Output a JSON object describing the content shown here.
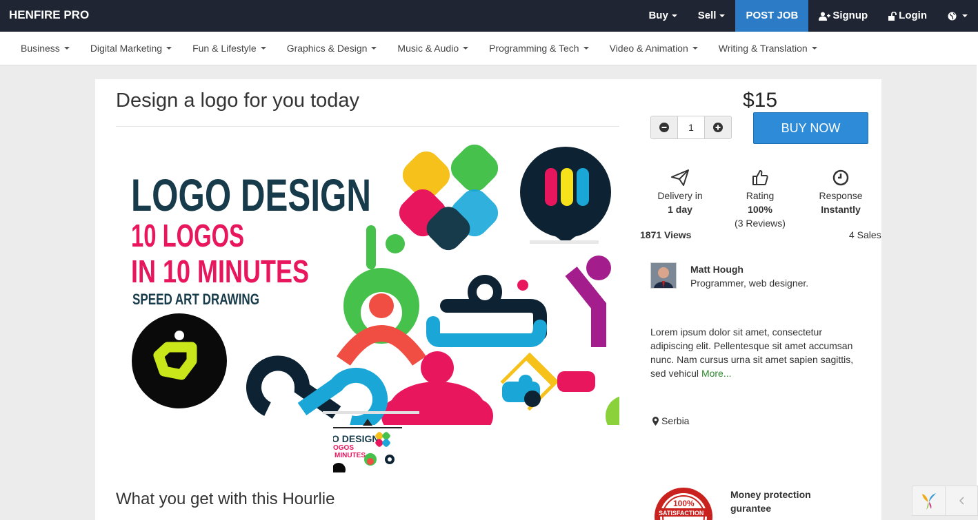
{
  "brand": "HENFIRE PRO",
  "topnav": {
    "buy": "Buy",
    "sell": "Sell",
    "post_job": "POST JOB",
    "signup": "Signup",
    "login": "Login"
  },
  "categories": [
    "Business",
    "Digital Marketing",
    "Fun & Lifestyle",
    "Graphics & Design",
    "Music & Audio",
    "Programming & Tech",
    "Video & Animation",
    "Writing & Translation"
  ],
  "gig": {
    "title": "Design a logo for you today",
    "price": "$15",
    "quantity": "1",
    "buy_label": "BUY NOW",
    "image_text": {
      "line1": "LOGO DESIGN",
      "line2": "10 LOGOS",
      "line3": "IN 10 MINUTES",
      "line4": "SPEED ART DRAWING"
    },
    "thumb_text": {
      "line1": "O DESIGN",
      "line2": "OGOS",
      "line3": "MINUTES"
    }
  },
  "stats": {
    "delivery_label": "Delivery in",
    "delivery_value": "1 day",
    "rating_label": "Rating",
    "rating_value": "100%",
    "rating_reviews": "(3 Reviews)",
    "response_label": "Response",
    "response_value": "Instantly",
    "views": "1871 Views",
    "sales": "4 Sales"
  },
  "seller": {
    "name": "Matt Hough",
    "role": "Programmer, web designer.",
    "description": "Lorem ipsum dolor sit amet, consectetur adipiscing elit. Pellentesque sit amet accumsan nunc. Nam cursus urna sit amet sapien sagittis, sed vehicul",
    "more_label": "More...",
    "location": "Serbia"
  },
  "section_heading": "What you get with this Hourlie",
  "guarantee": {
    "title_line1": "Money protection",
    "title_line2": "gurantee",
    "badge_text1": "100%",
    "badge_text2": "SATISFACTION"
  },
  "colors": {
    "topbar": "#1f2532",
    "accent": "#2b7bc6",
    "buy_button": "#2d8bd7",
    "more_link": "#2a8a2a"
  }
}
